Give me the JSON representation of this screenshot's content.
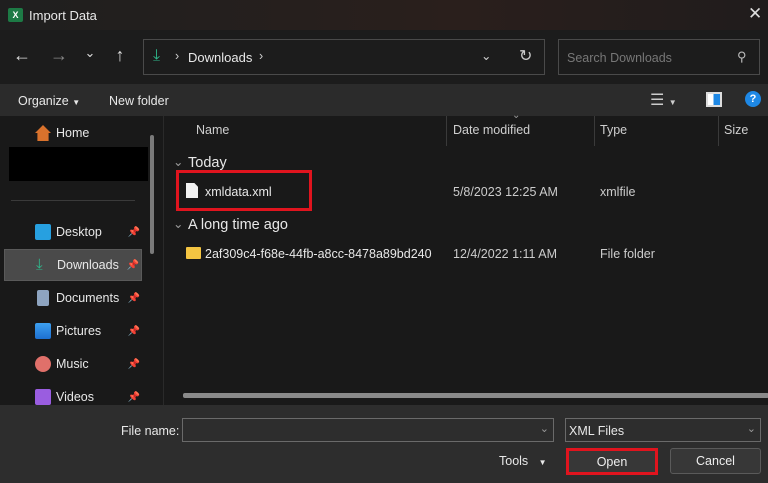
{
  "window": {
    "title": "Import Data",
    "app_icon": "excel-icon"
  },
  "nav": {
    "breadcrumb": "Downloads",
    "search_placeholder": "Search Downloads"
  },
  "commands": {
    "organize": "Organize",
    "new_folder": "New folder"
  },
  "sidebar": {
    "items": [
      {
        "label": "Home"
      },
      {
        "label": "Desktop"
      },
      {
        "label": "Downloads"
      },
      {
        "label": "Documents"
      },
      {
        "label": "Pictures"
      },
      {
        "label": "Music"
      },
      {
        "label": "Videos"
      }
    ]
  },
  "columns": {
    "name": "Name",
    "date": "Date modified",
    "type": "Type",
    "size": "Size"
  },
  "groups": [
    {
      "label": "Today",
      "files": [
        {
          "name": "xmldata.xml",
          "date": "5/8/2023 12:25 AM",
          "type": "xmlfile"
        }
      ]
    },
    {
      "label": "A long time ago",
      "files": [
        {
          "name": "2af309c4-f68e-44fb-a8cc-8478a89bd240",
          "date": "12/4/2022 1:11 AM",
          "type": "File folder"
        }
      ]
    }
  ],
  "bottom": {
    "file_name_label": "File name:",
    "file_name_value": "",
    "file_type": "XML Files",
    "tools": "Tools",
    "open": "Open",
    "cancel": "Cancel"
  },
  "colors": {
    "highlight": "#e0141e",
    "accent": "#2fb98c"
  }
}
